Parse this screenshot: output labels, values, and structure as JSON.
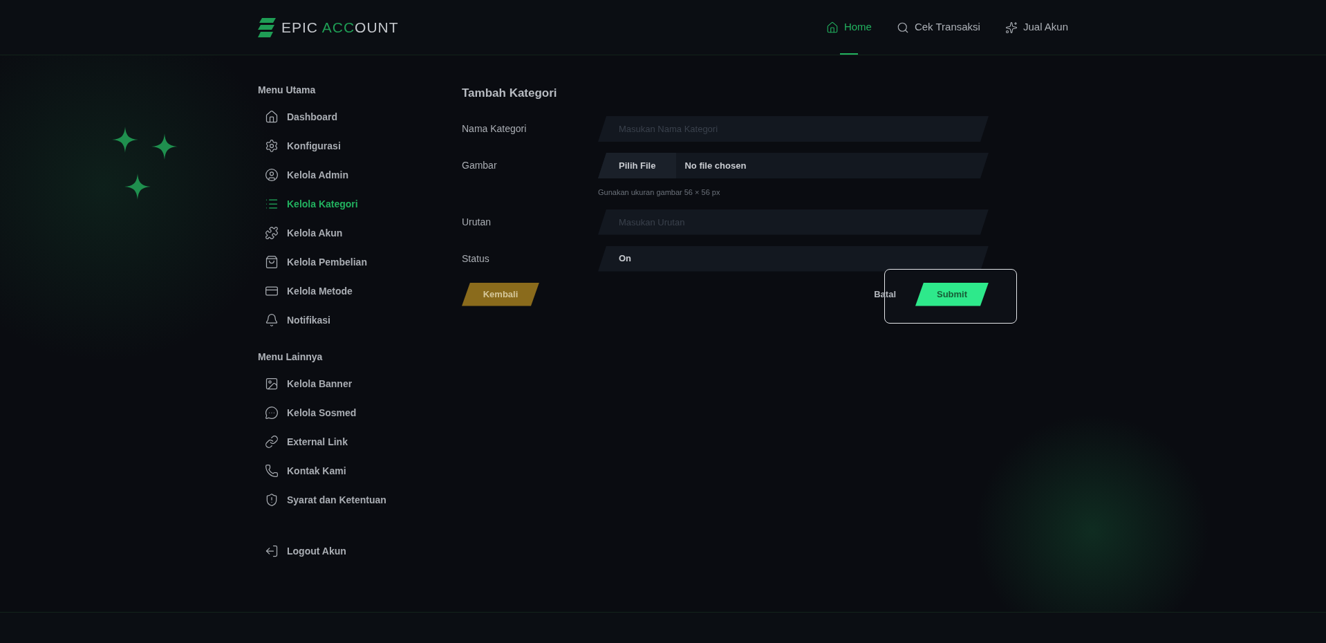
{
  "header": {
    "logo": {
      "part_1": "EPIC ",
      "part_2": "ACC",
      "part_3": "OUNT"
    },
    "nav": [
      {
        "label": "Home",
        "selected": true
      },
      {
        "label": "Cek Transaksi",
        "selected": false
      },
      {
        "label": "Jual Akun",
        "selected": false
      }
    ]
  },
  "sidebar": {
    "sections": [
      {
        "title": "Menu Utama",
        "items": [
          {
            "label": "Dashboard",
            "selected": false
          },
          {
            "label": "Konfigurasi",
            "selected": false
          },
          {
            "label": "Kelola Admin",
            "selected": false
          },
          {
            "label": "Kelola Kategori",
            "selected": true
          },
          {
            "label": "Kelola Akun",
            "selected": false
          },
          {
            "label": "Kelola Pembelian",
            "selected": false
          },
          {
            "label": "Kelola Metode",
            "selected": false
          },
          {
            "label": "Notifikasi",
            "selected": false
          }
        ]
      },
      {
        "title": "Menu Lainnya",
        "items": [
          {
            "label": "Kelola Banner",
            "selected": false
          },
          {
            "label": "Kelola Sosmed",
            "selected": false
          },
          {
            "label": "External Link",
            "selected": false
          },
          {
            "label": "Kontak Kami",
            "selected": false
          },
          {
            "label": "Syarat dan Ketentuan",
            "selected": false
          }
        ]
      }
    ],
    "logout": "Logout Akun"
  },
  "form": {
    "title": "Tambah Kategori",
    "fields": [
      {
        "kind": "text",
        "label": "Nama Kategori",
        "placeholder": "Masukan Nama Kategori"
      },
      {
        "kind": "file",
        "label": "Gambar",
        "button": "Pilih File",
        "value": "No file chosen",
        "hint": "Gunakan ukuran gambar 56 × 56 px"
      },
      {
        "kind": "text",
        "label": "Urutan",
        "placeholder": "Masukan Urutan"
      },
      {
        "kind": "select",
        "label": "Status",
        "value": "On"
      }
    ],
    "back_button": "Kembali",
    "cancel_button": "Batal",
    "submit_button": "Submit"
  }
}
